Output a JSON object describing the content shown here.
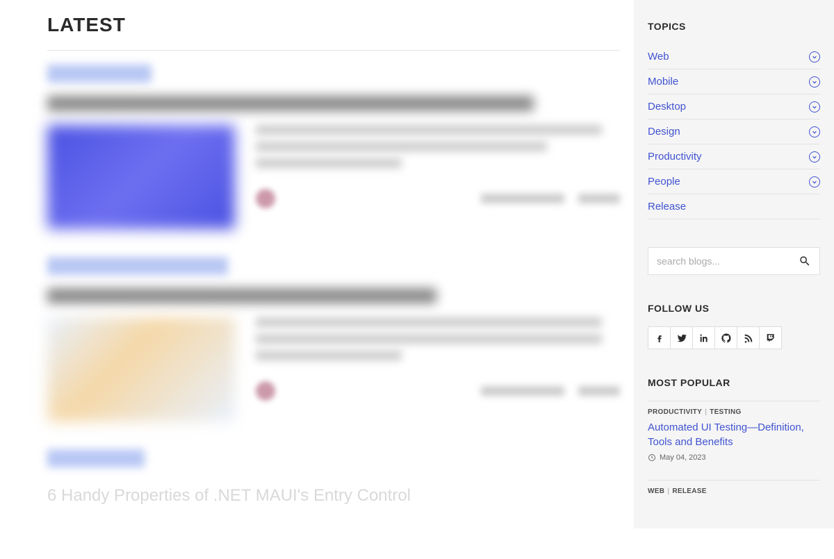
{
  "main": {
    "heading": "LATEST",
    "partial_post_title": "6 Handy Properties of .NET MAUI's Entry Control"
  },
  "sidebar": {
    "topics_heading": "TOPICS",
    "topics": [
      {
        "label": "Web",
        "expandable": true
      },
      {
        "label": "Mobile",
        "expandable": true
      },
      {
        "label": "Desktop",
        "expandable": true
      },
      {
        "label": "Design",
        "expandable": true
      },
      {
        "label": "Productivity",
        "expandable": true
      },
      {
        "label": "People",
        "expandable": true
      },
      {
        "label": "Release",
        "expandable": false
      }
    ],
    "search_placeholder": "search blogs...",
    "follow_heading": "FOLLOW US",
    "social": [
      "facebook",
      "twitter",
      "linkedin",
      "github",
      "rss",
      "twitch"
    ],
    "popular_heading": "MOST POPULAR",
    "popular": [
      {
        "tags": [
          "PRODUCTIVITY",
          "TESTING"
        ],
        "title": "Automated UI Testing—Definition, Tools and Benefits",
        "date": "May 04, 2023"
      },
      {
        "tags": [
          "WEB",
          "RELEASE"
        ],
        "title": "",
        "date": ""
      }
    ]
  }
}
